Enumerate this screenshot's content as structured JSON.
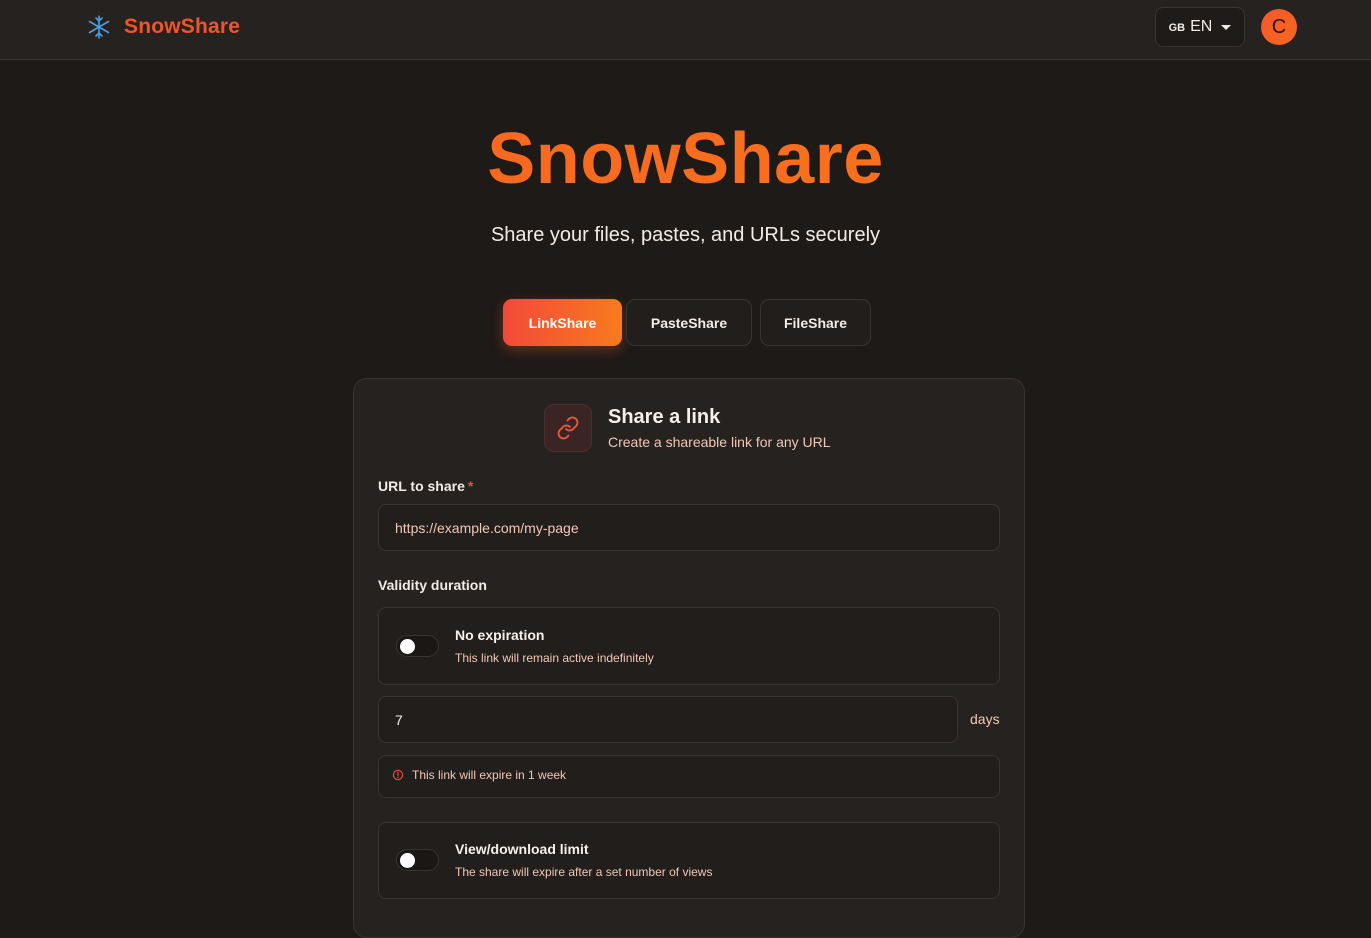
{
  "header": {
    "brand": "SnowShare",
    "language_flag": "GB",
    "language": "EN",
    "avatar_initial": "C"
  },
  "hero": {
    "title": "SnowShare",
    "subtitle": "Share your files, pastes, and URLs securely"
  },
  "tabs": [
    {
      "label": "LinkShare",
      "active": true
    },
    {
      "label": "PasteShare",
      "active": false
    },
    {
      "label": "FileShare",
      "active": false
    }
  ],
  "card": {
    "title": "Share a link",
    "subtitle": "Create a shareable link for any URL",
    "url_label": "URL to share",
    "url_required": "*",
    "url_placeholder": "https://example.com/my-page",
    "validity_label": "Validity duration",
    "no_expiration": {
      "title": "No expiration",
      "description": "This link will remain active indefinitely",
      "enabled": false
    },
    "duration_value": "7",
    "duration_unit": "days",
    "expiry_notice": "This link will expire in 1 week",
    "view_limit": {
      "title": "View/download limit",
      "description": "The share will expire after a set number of views",
      "enabled": false
    }
  },
  "colors": {
    "accent": "#f65f24",
    "background": "#1e1a18",
    "surface": "#262220",
    "danger": "#f04a3a"
  }
}
